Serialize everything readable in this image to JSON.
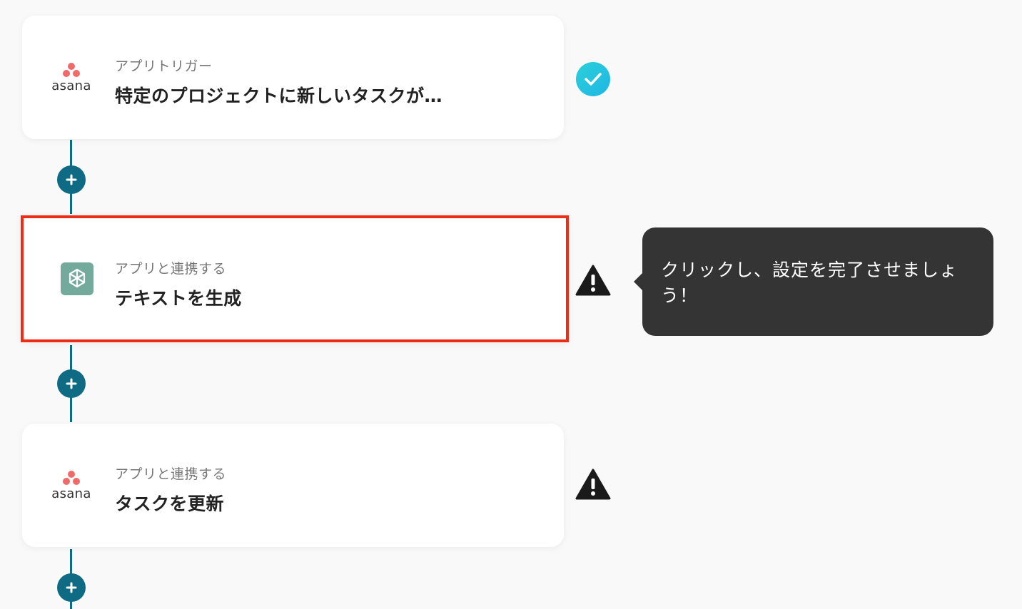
{
  "steps": [
    {
      "subtitle": "アプリトリガー",
      "title": "特定のプロジェクトに新しいタスクが…",
      "app": "asana",
      "icon": "asana-logo-icon",
      "status": "complete",
      "status_icon": "check-circle-icon",
      "status_color": "#1fc3e0"
    },
    {
      "subtitle": "アプリと連携する",
      "title": "テキストを生成",
      "app": "ChatGPT",
      "icon": "chatgpt-logo-icon",
      "status": "warning",
      "status_icon": "warning-triangle-icon",
      "highlight_color": "#ee2b15"
    },
    {
      "subtitle": "アプリと連携する",
      "title": "タスクを更新",
      "app": "asana",
      "icon": "asana-logo-icon",
      "status": "warning",
      "status_icon": "warning-triangle-icon"
    }
  ],
  "tooltip": {
    "text": "クリックし、設定を完了させましょう！"
  },
  "colors": {
    "connector": "#0f6b83",
    "asana_dots": "#f06a6a",
    "chatgpt_bg": "#74aa9c",
    "tooltip_bg": "#343434"
  },
  "add_step_icon": "plus-icon"
}
